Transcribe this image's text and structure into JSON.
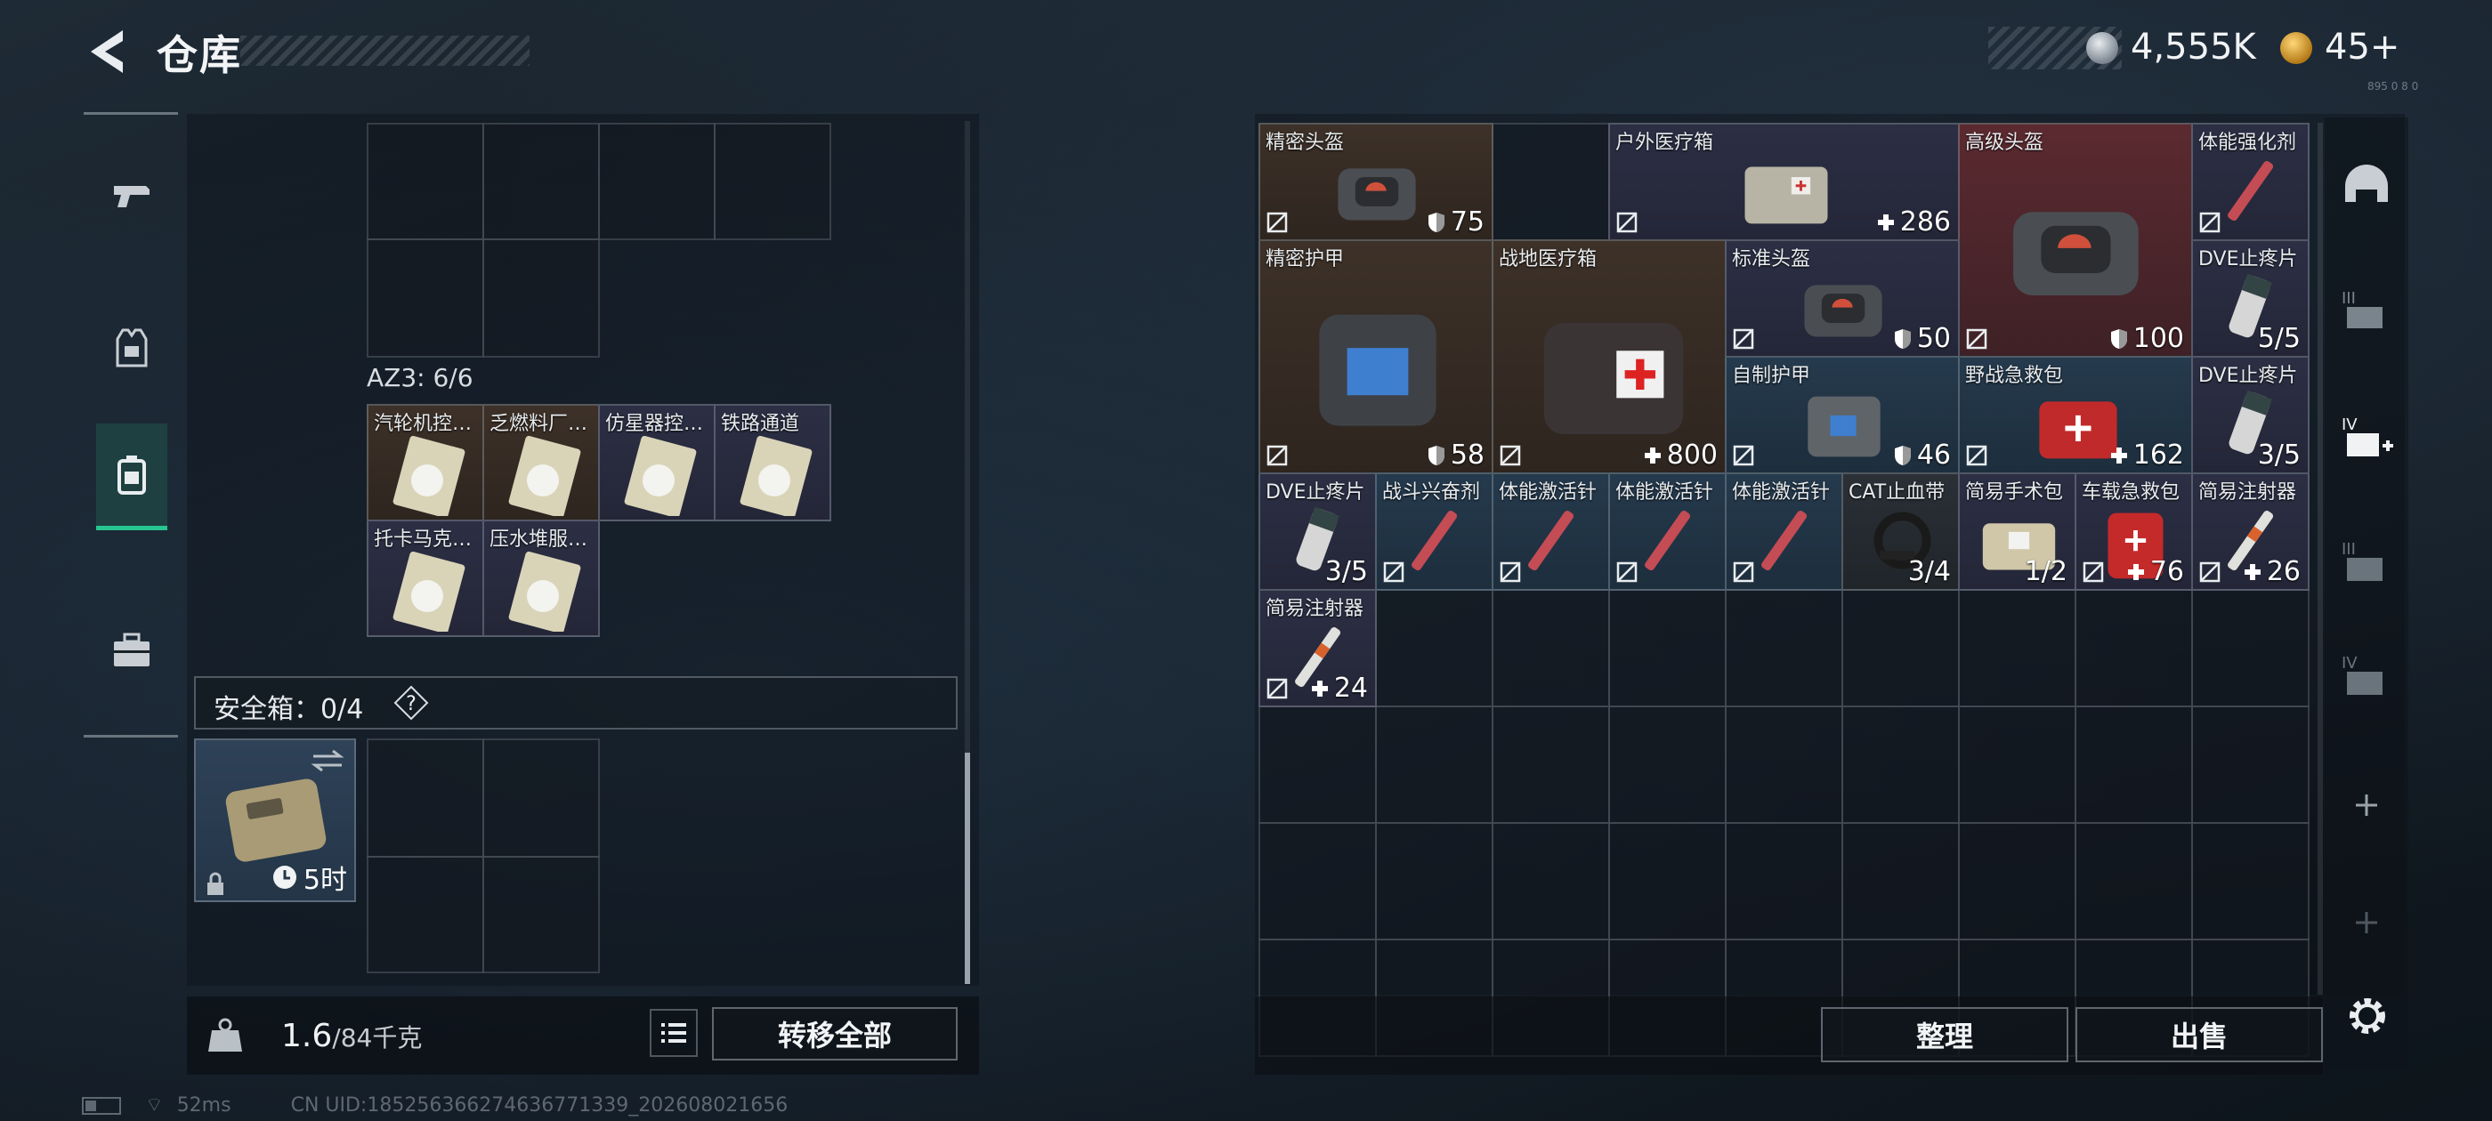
{
  "header": {
    "title": "仓库",
    "currency_silver": "4,555K",
    "currency_gold": "45+",
    "corner_tiny": "895 0 8 0"
  },
  "left_nav": {
    "items": [
      {
        "id": "weapons",
        "icon": "pistol-icon"
      },
      {
        "id": "gear",
        "icon": "vest-icon"
      },
      {
        "id": "backpack",
        "icon": "backpack-icon",
        "active": true
      },
      {
        "id": "case",
        "icon": "briefcase-icon"
      }
    ]
  },
  "stash": {
    "az3_label": "AZ3: 6/6",
    "az3_items": [
      {
        "name": "汽轮机控…"
      },
      {
        "name": "乏燃料厂…"
      },
      {
        "name": "仿星器控…"
      },
      {
        "name": "铁路通道"
      },
      {
        "name": "托卡马克…"
      },
      {
        "name": "压水堆服…"
      }
    ],
    "safebox_label": "安全箱：0/4",
    "safebox_help": "?",
    "safebox_timer": "5时",
    "weight_current": "1.6",
    "weight_max": "/84千克",
    "transfer_all": "转移全部"
  },
  "container": {
    "items": [
      {
        "name": "精密头盔",
        "value": "75",
        "type": "shield",
        "color": "brown"
      },
      {
        "name": "户外医疗箱",
        "value": "286",
        "type": "plus",
        "color": "navy"
      },
      {
        "name": "高级头盔",
        "value": "100",
        "type": "shield",
        "color": "red"
      },
      {
        "name": "体能强化剂",
        "value": "",
        "type": "none",
        "color": "navy"
      },
      {
        "name": "精密护甲",
        "value": "58",
        "type": "shield",
        "color": "brown"
      },
      {
        "name": "战地医疗箱",
        "value": "800",
        "type": "plus",
        "color": "brown"
      },
      {
        "name": "标准头盔",
        "value": "50",
        "type": "shield",
        "color": "navy"
      },
      {
        "name": "DVE止疼片",
        "value": "5/5",
        "type": "count",
        "color": "navy"
      },
      {
        "name": "自制护甲",
        "value": "46",
        "type": "shield",
        "color": "blue"
      },
      {
        "name": "野战急救包",
        "value": "162",
        "type": "plus",
        "color": "blue"
      },
      {
        "name": "DVE止疼片",
        "value": "3/5",
        "type": "count",
        "color": "navy"
      },
      {
        "name": "DVE止疼片",
        "value": "3/5",
        "type": "count",
        "color": "navy"
      },
      {
        "name": "战斗兴奋剂",
        "value": "",
        "type": "none",
        "color": "blue"
      },
      {
        "name": "体能激活针",
        "value": "",
        "type": "none",
        "color": "blue"
      },
      {
        "name": "体能激活针",
        "value": "",
        "type": "none",
        "color": "blue"
      },
      {
        "name": "体能激活针",
        "value": "",
        "type": "none",
        "color": "blue"
      },
      {
        "name": "CAT止血带",
        "value": "3/4",
        "type": "count",
        "color": "grey"
      },
      {
        "name": "简易手术包",
        "value": "1/2",
        "type": "count",
        "color": "navy"
      },
      {
        "name": "车载急救包",
        "value": "76",
        "type": "plus",
        "color": "navy"
      },
      {
        "name": "简易注射器",
        "value": "26",
        "type": "plus",
        "color": "navy"
      },
      {
        "name": "简易注射器",
        "value": "24",
        "type": "plus",
        "color": "navy"
      }
    ],
    "organize": "整理",
    "sell": "出售"
  },
  "status": {
    "ping": "52ms",
    "uid": "CN UID:1852563662746367713​39_202608021656"
  }
}
